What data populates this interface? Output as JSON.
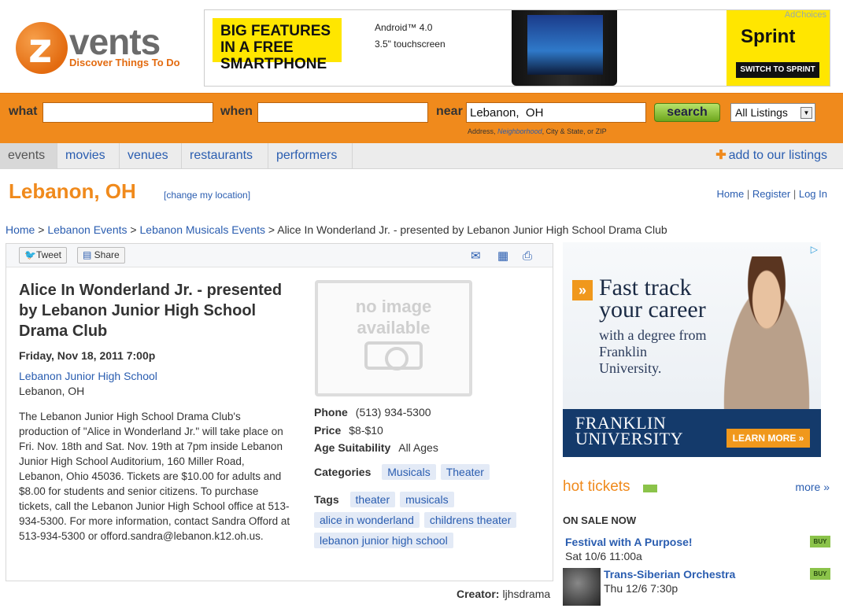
{
  "logo": {
    "letter": "z",
    "name": "vents",
    "tagline": "Discover Things To Do"
  },
  "top_ad": {
    "headline": "BIG FEATURES IN A FREE SMARTPHONE",
    "spec_1": "Android™ 4.0",
    "spec_2": "3.5\" touchscreen",
    "brand": "Sprint",
    "cta": "SWITCH TO SPRINT",
    "adchoices": "AdChoices"
  },
  "search": {
    "what_label": "what",
    "when_label": "when",
    "near_label": "near",
    "what_value": "",
    "when_value": "",
    "near_value": "Lebanon,  OH",
    "button": "search",
    "listing_filter": "All Listings",
    "hint_pre": "Address, ",
    "hint_link": "Neighborhood",
    "hint_post": ", City & State, or ZIP"
  },
  "nav": {
    "tabs": [
      "events",
      "movies",
      "venues",
      "restaurants",
      "performers"
    ],
    "add": "add to our listings"
  },
  "location": {
    "title": "Lebanon, OH",
    "change": "[change my location]"
  },
  "account": {
    "home": "Home",
    "register": "Register",
    "login": "Log In"
  },
  "breadcrumb": {
    "home": "Home",
    "events": "Lebanon Events",
    "category": "Lebanon Musicals Events",
    "current": "Alice In Wonderland Jr. - presented by Lebanon Junior High School Drama Club"
  },
  "toolbar": {
    "tweet": "Tweet",
    "share": "Share"
  },
  "event": {
    "title": "Alice In Wonderland Jr. - presented by Lebanon Junior High School Drama Club",
    "date": "Friday, Nov 18, 2011 7:00p",
    "venue": "Lebanon Junior High School",
    "city": "Lebanon, OH",
    "description": "The Lebanon Junior High School Drama Club's production of \"Alice in Wonderland Jr.\" will take place on Fri. Nov. 18th and Sat. Nov. 19th at 7pm inside Lebanon Junior High School Auditorium, 160 Miller Road, Lebanon, Ohio 45036. Tickets are $10.00 for adults and $8.00 for students and senior citizens. To purchase tickets, call the Lebanon Junior High School office at 513-934-5300. For more information, contact Sandra Offord at 513-934-5300 or offord.sandra@lebanon.k12.oh.us.",
    "no_image_1": "no image",
    "no_image_2": "available",
    "phone_label": "Phone",
    "phone": "(513) 934-5300",
    "price_label": "Price",
    "price": "$8-$10",
    "age_label": "Age Suitability",
    "age": "All Ages",
    "categories_label": "Categories",
    "categories": [
      "Musicals",
      "Theater"
    ],
    "tags_label": "Tags",
    "tags": [
      "theater",
      "musicals",
      "alice in wonderland",
      "childrens theater",
      "lebanon junior high school"
    ],
    "creator_label": "Creator:",
    "creator": "ljhsdrama"
  },
  "right_ad": {
    "headline": "Fast track your career",
    "sub": "with a degree from Franklin University.",
    "university": "FRANKLIN UNIVERSITY",
    "cta": "LEARN MORE »"
  },
  "hot_tickets": {
    "title": "hot tickets",
    "more": "more »",
    "on_sale": "ON SALE NOW",
    "items": [
      {
        "name": "Festival with A Purpose!",
        "date": "Sat 10/6 11:00a",
        "buy": "BUY"
      },
      {
        "name": "Trans-Siberian Orchestra",
        "date": "Thu 12/6 7:30p",
        "buy": "BUY"
      }
    ]
  },
  "colors": {
    "accent": "#f08a1c",
    "link": "#2a5db0"
  }
}
